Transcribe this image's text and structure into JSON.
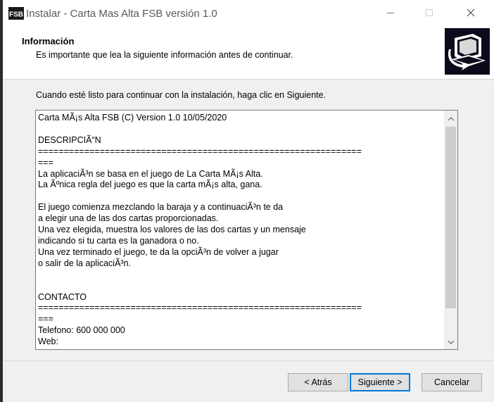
{
  "window": {
    "title": "Instalar - Carta Mas Alta FSB versión 1.0",
    "app_icon": "fsb-logo-icon",
    "controls": {
      "minimize": "minimize-icon",
      "maximize": "maximize-icon",
      "close": "close-icon"
    }
  },
  "header": {
    "title": "Información",
    "subtitle": "Es importante que lea la siguiente información antes de continuar.",
    "icon": "installer-computer-icon"
  },
  "intro": "Cuando esté listo para continuar con la instalación, haga clic en Siguiente.",
  "memo": {
    "lines": [
      "Carta MÃ¡s Alta FSB (C) Version 1.0 10/05/2020",
      "",
      "DESCRIPCIÃ“N",
      "===============================================================",
      "===",
      "La aplicaciÃ³n se basa en el juego de La Carta MÃ¡s Alta.",
      "La Ãºnica regla del juego es que la carta mÃ¡s alta, gana.",
      "",
      "El juego comienza mezclando la baraja y a continuaciÃ³n te da",
      "a elegir una de las dos cartas proporcionadas.",
      "Una vez elegida, muestra los valores de las dos cartas y un mensaje",
      "indicando si tu carta es la ganadora o no.",
      "Una vez terminado el juego, te da la opciÃ³n de volver a jugar",
      "o salir de la aplicaciÃ³n.",
      "",
      "",
      "CONTACTO",
      "===============================================================",
      "===",
      "Telefono: 600 000 000",
      "Web:"
    ],
    "scroll_position": 0.0
  },
  "buttons": {
    "back": "< Atrás",
    "next": "Siguiente >",
    "cancel": "Cancelar"
  },
  "colors": {
    "accent": "#0078d7",
    "header_bg": "#ffffff",
    "dialog_bg": "#f0f0f0"
  }
}
